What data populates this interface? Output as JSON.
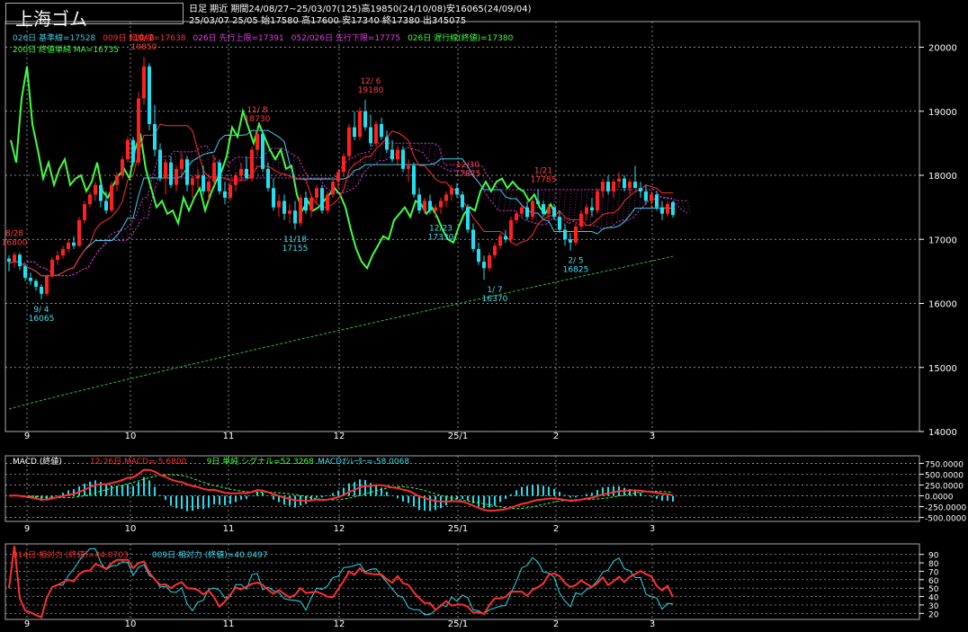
{
  "header": {
    "title": "上海ゴム",
    "line1": "日足 期近 期間24/08/27~25/03/07(125)高19850(24/10/08)安16065(24/09/04)",
    "line2": "25/03/07 25/05 始17580 高17600 安17340 終17380 出345075",
    "legend_row1": [
      {
        "text": "026日 基準線=17528",
        "color": "#40c8e0"
      },
      {
        "text": "009日 転換線=17638",
        "color": "#ff3030"
      },
      {
        "text": "026日 先行上限=17391",
        "color": "#e040e0"
      },
      {
        "text": "052/026日 先行下限=17775",
        "color": "#e040e0"
      },
      {
        "text": "026日 遅行線(終値)=17380",
        "color": "#40ff40"
      }
    ],
    "legend_row2": [
      {
        "text": "200日 終値単純 MA=16735",
        "color": "#40ff40"
      }
    ]
  },
  "colors": {
    "up": "#ff2020",
    "down": "#20e0f0",
    "kijun": "#40d0f0",
    "tenkan": "#ff3030",
    "chikou": "#40ff40",
    "ma": "#30c030",
    "cloud": "#d040d0",
    "grid": "#bbbbbb"
  },
  "chart_data": [
    {
      "type": "candlestick",
      "x_labels": [
        "9",
        "10",
        "11",
        "12",
        "25/1",
        "2",
        "3"
      ],
      "y_ticks": [
        14000,
        15000,
        16000,
        17000,
        18000,
        19000,
        20000
      ],
      "ylim": [
        14000,
        20400
      ],
      "annotations": [
        {
          "label": "8/28",
          "value": "16800",
          "x_index": 1,
          "color": "#ff4040"
        },
        {
          "label": "9/ 4",
          "value": "16065",
          "x_index": 6,
          "color": "#40e0f0"
        },
        {
          "label": "10/ 8",
          "value": "19850",
          "x_index": 25,
          "color": "#ff4040"
        },
        {
          "label": "11/ 8",
          "value": "18730",
          "x_index": 46,
          "color": "#ff4040"
        },
        {
          "label": "11/18",
          "value": "17155",
          "x_index": 53,
          "color": "#40e0f0"
        },
        {
          "label": "12/ 6",
          "value": "19180",
          "x_index": 67,
          "color": "#ff4040"
        },
        {
          "label": "12/23",
          "value": "17330",
          "x_index": 80,
          "color": "#40e0f0"
        },
        {
          "label": "12/30",
          "value": "17875",
          "x_index": 85,
          "color": "#ff4040"
        },
        {
          "label": "1/ 7",
          "value": "16370",
          "x_index": 90,
          "color": "#40e0f0"
        },
        {
          "label": "1/21",
          "value": "17785",
          "x_index": 99,
          "color": "#ff4040"
        },
        {
          "label": "2/ 5",
          "value": "16825",
          "x_index": 105,
          "color": "#40e0f0"
        }
      ],
      "ohlc": [
        [
          16700,
          16750,
          16500,
          16650
        ],
        [
          16650,
          16800,
          16560,
          16760
        ],
        [
          16760,
          16790,
          16520,
          16580
        ],
        [
          16580,
          16620,
          16350,
          16400
        ],
        [
          16400,
          16480,
          16290,
          16350
        ],
        [
          16350,
          16380,
          16200,
          16260
        ],
        [
          16260,
          16300,
          16065,
          16150
        ],
        [
          16150,
          16450,
          16120,
          16420
        ],
        [
          16420,
          16720,
          16400,
          16680
        ],
        [
          16680,
          16820,
          16600,
          16750
        ],
        [
          16750,
          16900,
          16700,
          16850
        ],
        [
          16850,
          17000,
          16800,
          16950
        ],
        [
          16950,
          17050,
          16850,
          16900
        ],
        [
          16900,
          17350,
          16880,
          17300
        ],
        [
          17300,
          17600,
          17250,
          17550
        ],
        [
          17550,
          17750,
          17500,
          17700
        ],
        [
          17700,
          17900,
          17600,
          17850
        ],
        [
          17850,
          17900,
          17500,
          17600
        ],
        [
          17600,
          17750,
          17400,
          17450
        ],
        [
          17450,
          17900,
          17420,
          17850
        ],
        [
          17850,
          18050,
          17750,
          18000
        ],
        [
          18000,
          18300,
          17950,
          18250
        ],
        [
          18250,
          18600,
          18200,
          18550
        ],
        [
          18550,
          18600,
          18150,
          18200
        ],
        [
          18200,
          19300,
          18150,
          19200
        ],
        [
          19200,
          19850,
          19100,
          19700
        ],
        [
          19700,
          19750,
          18700,
          18800
        ],
        [
          18800,
          19100,
          18300,
          18400
        ],
        [
          18400,
          18500,
          17900,
          17950
        ],
        [
          17950,
          18250,
          17700,
          18200
        ],
        [
          18200,
          18300,
          17800,
          17850
        ],
        [
          17850,
          18150,
          17750,
          18100
        ],
        [
          18100,
          18350,
          17950,
          18250
        ],
        [
          18250,
          18300,
          17750,
          17850
        ],
        [
          17850,
          18000,
          17650,
          17950
        ],
        [
          17950,
          18100,
          17800,
          18000
        ],
        [
          18000,
          18150,
          17700,
          17750
        ],
        [
          17750,
          17950,
          17600,
          17900
        ],
        [
          17900,
          18300,
          17850,
          18200
        ],
        [
          18200,
          18250,
          17700,
          17750
        ],
        [
          17750,
          17900,
          17550,
          17650
        ],
        [
          17650,
          17900,
          17600,
          17850
        ],
        [
          17850,
          18050,
          17750,
          18000
        ],
        [
          18000,
          18200,
          17900,
          18100
        ],
        [
          18100,
          18300,
          17950,
          17950
        ],
        [
          17950,
          18450,
          17900,
          18400
        ],
        [
          18400,
          18730,
          18300,
          18650
        ],
        [
          18650,
          18700,
          18050,
          18100
        ],
        [
          18100,
          18200,
          17750,
          17800
        ],
        [
          17800,
          17950,
          17450,
          17500
        ],
        [
          17500,
          17700,
          17350,
          17600
        ],
        [
          17600,
          17700,
          17300,
          17400
        ],
        [
          17400,
          17550,
          17250,
          17450
        ],
        [
          17450,
          17600,
          17155,
          17250
        ],
        [
          17250,
          17700,
          17200,
          17650
        ],
        [
          17650,
          17750,
          17400,
          17450
        ],
        [
          17450,
          17700,
          17350,
          17650
        ],
        [
          17650,
          17850,
          17550,
          17800
        ],
        [
          17800,
          17850,
          17400,
          17450
        ],
        [
          17450,
          17750,
          17400,
          17700
        ],
        [
          17700,
          17950,
          17650,
          17900
        ],
        [
          17900,
          18100,
          17800,
          18050
        ],
        [
          18050,
          18350,
          18000,
          18300
        ],
        [
          18300,
          18800,
          18250,
          18750
        ],
        [
          18750,
          19000,
          18550,
          18600
        ],
        [
          18600,
          19050,
          18550,
          19000
        ],
        [
          19000,
          19180,
          18700,
          18750
        ],
        [
          18750,
          18950,
          18450,
          18500
        ],
        [
          18500,
          18850,
          18450,
          18800
        ],
        [
          18800,
          18900,
          18550,
          18600
        ],
        [
          18600,
          18700,
          18350,
          18400
        ],
        [
          18400,
          18550,
          18200,
          18250
        ],
        [
          18250,
          18450,
          18150,
          18400
        ],
        [
          18400,
          18450,
          18050,
          18100
        ],
        [
          18100,
          18250,
          17900,
          18150
        ],
        [
          18150,
          18200,
          17650,
          17700
        ],
        [
          17700,
          17800,
          17400,
          17450
        ],
        [
          17450,
          17650,
          17400,
          17600
        ],
        [
          17600,
          17700,
          17400,
          17450
        ],
        [
          17450,
          17550,
          17330,
          17500
        ],
        [
          17500,
          17650,
          17400,
          17600
        ],
        [
          17600,
          17750,
          17500,
          17700
        ],
        [
          17700,
          17850,
          17600,
          17800
        ],
        [
          17800,
          17875,
          17650,
          17700
        ],
        [
          17700,
          17750,
          17450,
          17500
        ],
        [
          17500,
          17550,
          17100,
          17150
        ],
        [
          17150,
          17250,
          16800,
          16850
        ],
        [
          16850,
          16950,
          16600,
          16650
        ],
        [
          16650,
          16750,
          16370,
          16550
        ],
        [
          16550,
          16800,
          16500,
          16750
        ],
        [
          16750,
          16950,
          16700,
          16900
        ],
        [
          16900,
          17100,
          16850,
          17050
        ],
        [
          17050,
          17150,
          16950,
          17000
        ],
        [
          17000,
          17350,
          16950,
          17300
        ],
        [
          17300,
          17450,
          17250,
          17400
        ],
        [
          17400,
          17550,
          17350,
          17500
        ],
        [
          17500,
          17600,
          17300,
          17350
        ],
        [
          17350,
          17650,
          17300,
          17600
        ],
        [
          17600,
          17785,
          17550,
          17550
        ],
        [
          17550,
          17600,
          17350,
          17400
        ],
        [
          17400,
          17550,
          17300,
          17500
        ],
        [
          17500,
          17550,
          17300,
          17350
        ],
        [
          17350,
          17450,
          17100,
          17150
        ],
        [
          17150,
          17250,
          16900,
          17000
        ],
        [
          17000,
          17100,
          16825,
          16950
        ],
        [
          16950,
          17250,
          16900,
          17200
        ],
        [
          17200,
          17450,
          17150,
          17400
        ],
        [
          17400,
          17550,
          17300,
          17500
        ],
        [
          17500,
          17650,
          17350,
          17450
        ],
        [
          17450,
          17800,
          17400,
          17750
        ],
        [
          17750,
          17950,
          17650,
          17900
        ],
        [
          17900,
          18000,
          17700,
          17750
        ],
        [
          17750,
          17950,
          17650,
          17900
        ],
        [
          17900,
          18050,
          17800,
          17950
        ],
        [
          17950,
          18000,
          17750,
          17800
        ],
        [
          17800,
          17950,
          17700,
          17900
        ],
        [
          17900,
          18150,
          17850,
          17800
        ],
        [
          17800,
          17900,
          17650,
          17750
        ],
        [
          17750,
          17850,
          17550,
          17600
        ],
        [
          17600,
          17750,
          17500,
          17700
        ],
        [
          17700,
          17750,
          17450,
          17500
        ],
        [
          17500,
          17600,
          17300,
          17400
        ],
        [
          17400,
          17600,
          17350,
          17550
        ],
        [
          17580,
          17600,
          17340,
          17380
        ]
      ]
    },
    {
      "type": "line",
      "name": "MACD",
      "label_prefix": "MACD (終値)",
      "legend": [
        {
          "text": "12-26日 MACD=-5.6800",
          "color": "#ff3030"
        },
        {
          "text": "9日 単純 シグナル=52.3268",
          "color": "#40ff40"
        },
        {
          "text": "MACDｵｼﾚｰﾀｰ=-58.0068",
          "color": "#40e0f0"
        }
      ],
      "y_ticks": [
        "750.0000",
        "500.0000",
        "250.0000",
        "0.0000",
        "-250.0000",
        "-500.0000"
      ],
      "ylim": [
        -550,
        800
      ]
    },
    {
      "type": "line",
      "name": "RSI",
      "legend": [
        {
          "text": "014日 相対力 (終値)=44.0703",
          "color": "#ff3030"
        },
        {
          "text": "009日 相対力 (終値)=40.0497",
          "color": "#40e0f0"
        }
      ],
      "y_ticks": [
        "90",
        "80",
        "70",
        "60",
        "50",
        "40",
        "30",
        "20"
      ],
      "ylim": [
        15,
        95
      ]
    }
  ]
}
